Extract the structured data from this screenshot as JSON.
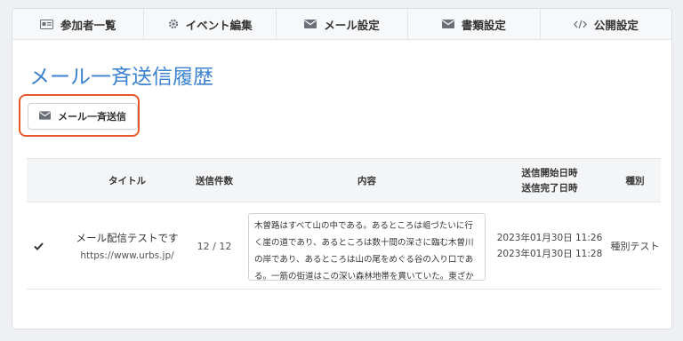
{
  "tabs": [
    {
      "label": "参加者一覧",
      "icon": "id-card-icon"
    },
    {
      "label": "イベント編集",
      "icon": "gear-icon"
    },
    {
      "label": "メール設定",
      "icon": "envelope-icon"
    },
    {
      "label": "書類設定",
      "icon": "envelope-icon"
    },
    {
      "label": "公開設定",
      "icon": "code-icon"
    }
  ],
  "page_title": "メール一斉送信履歴",
  "send_button_label": "メール一斉送信",
  "accent_color": "#3b82d0",
  "highlight_color": "#e8562b",
  "table": {
    "headers": {
      "title": "タイトル",
      "count": "送信件数",
      "content": "内容",
      "start": "送信開始日時",
      "end": "送信完了日時",
      "type": "種別"
    },
    "rows": [
      {
        "status_icon": "check-icon",
        "title": "メール配信テストです",
        "url": "https://www.urbs.jp/",
        "count": "12 / 12",
        "content": "木曽路はすべて山の中である。あるところは岨づたいに行く崖の道であり、あるところは数十間の深さに臨む木曽川の岸であり、あるところは山の尾をめぐる谷の入り口である。一筋の街道はこの深い森林地帯を貫いていた。東ざかいの桜沢",
        "start": "2023年01月30日 11:26",
        "end": "2023年01月30日 11:28",
        "type": "種別テスト"
      }
    ]
  }
}
